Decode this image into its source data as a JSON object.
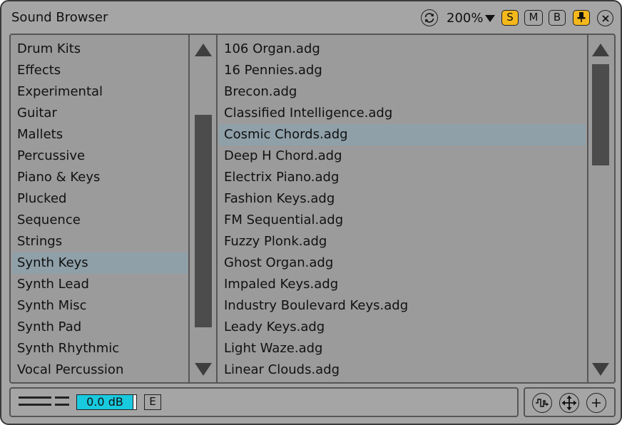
{
  "window": {
    "title": "Sound Browser"
  },
  "toolbar": {
    "zoom_label": "200%",
    "buttons": {
      "solo": "S",
      "mute": "M",
      "browse": "B"
    },
    "accent_color": "#f5b81c"
  },
  "categories": {
    "items": [
      "Drum Kits",
      "Effects",
      "Experimental",
      "Guitar",
      "Mallets",
      "Percussive",
      "Piano & Keys",
      "Plucked",
      "Sequence",
      "Strings",
      "Synth Keys",
      "Synth Lead",
      "Synth Misc",
      "Synth Pad",
      "Synth Rhythmic",
      "Vocal Percussion"
    ],
    "selected": "Synth Keys"
  },
  "presets": {
    "items": [
      "106 Organ.adg",
      "16 Pennies.adg",
      "Brecon.adg",
      "Classified Intelligence.adg",
      "Cosmic Chords.adg",
      "Deep H Chord.adg",
      "Electrix Piano.adg",
      "Fashion Keys.adg",
      "FM Sequential.adg",
      "Fuzzy Plonk.adg",
      "Ghost Organ.adg",
      "Impaled Keys.adg",
      "Industry Boulevard Keys.adg",
      "Leady Keys.adg",
      "Light Waze.adg",
      "Linear Clouds.adg"
    ],
    "selected": "Cosmic Chords.adg"
  },
  "footer": {
    "gain_label": "0.0 dB",
    "edit_label": "E",
    "gain_color": "#19c9de"
  },
  "icons": {
    "refresh": "refresh-icon",
    "pin": "pin-icon",
    "close": "close-icon",
    "preview": "preview-icon",
    "move": "move-icon",
    "add": "add-icon"
  }
}
